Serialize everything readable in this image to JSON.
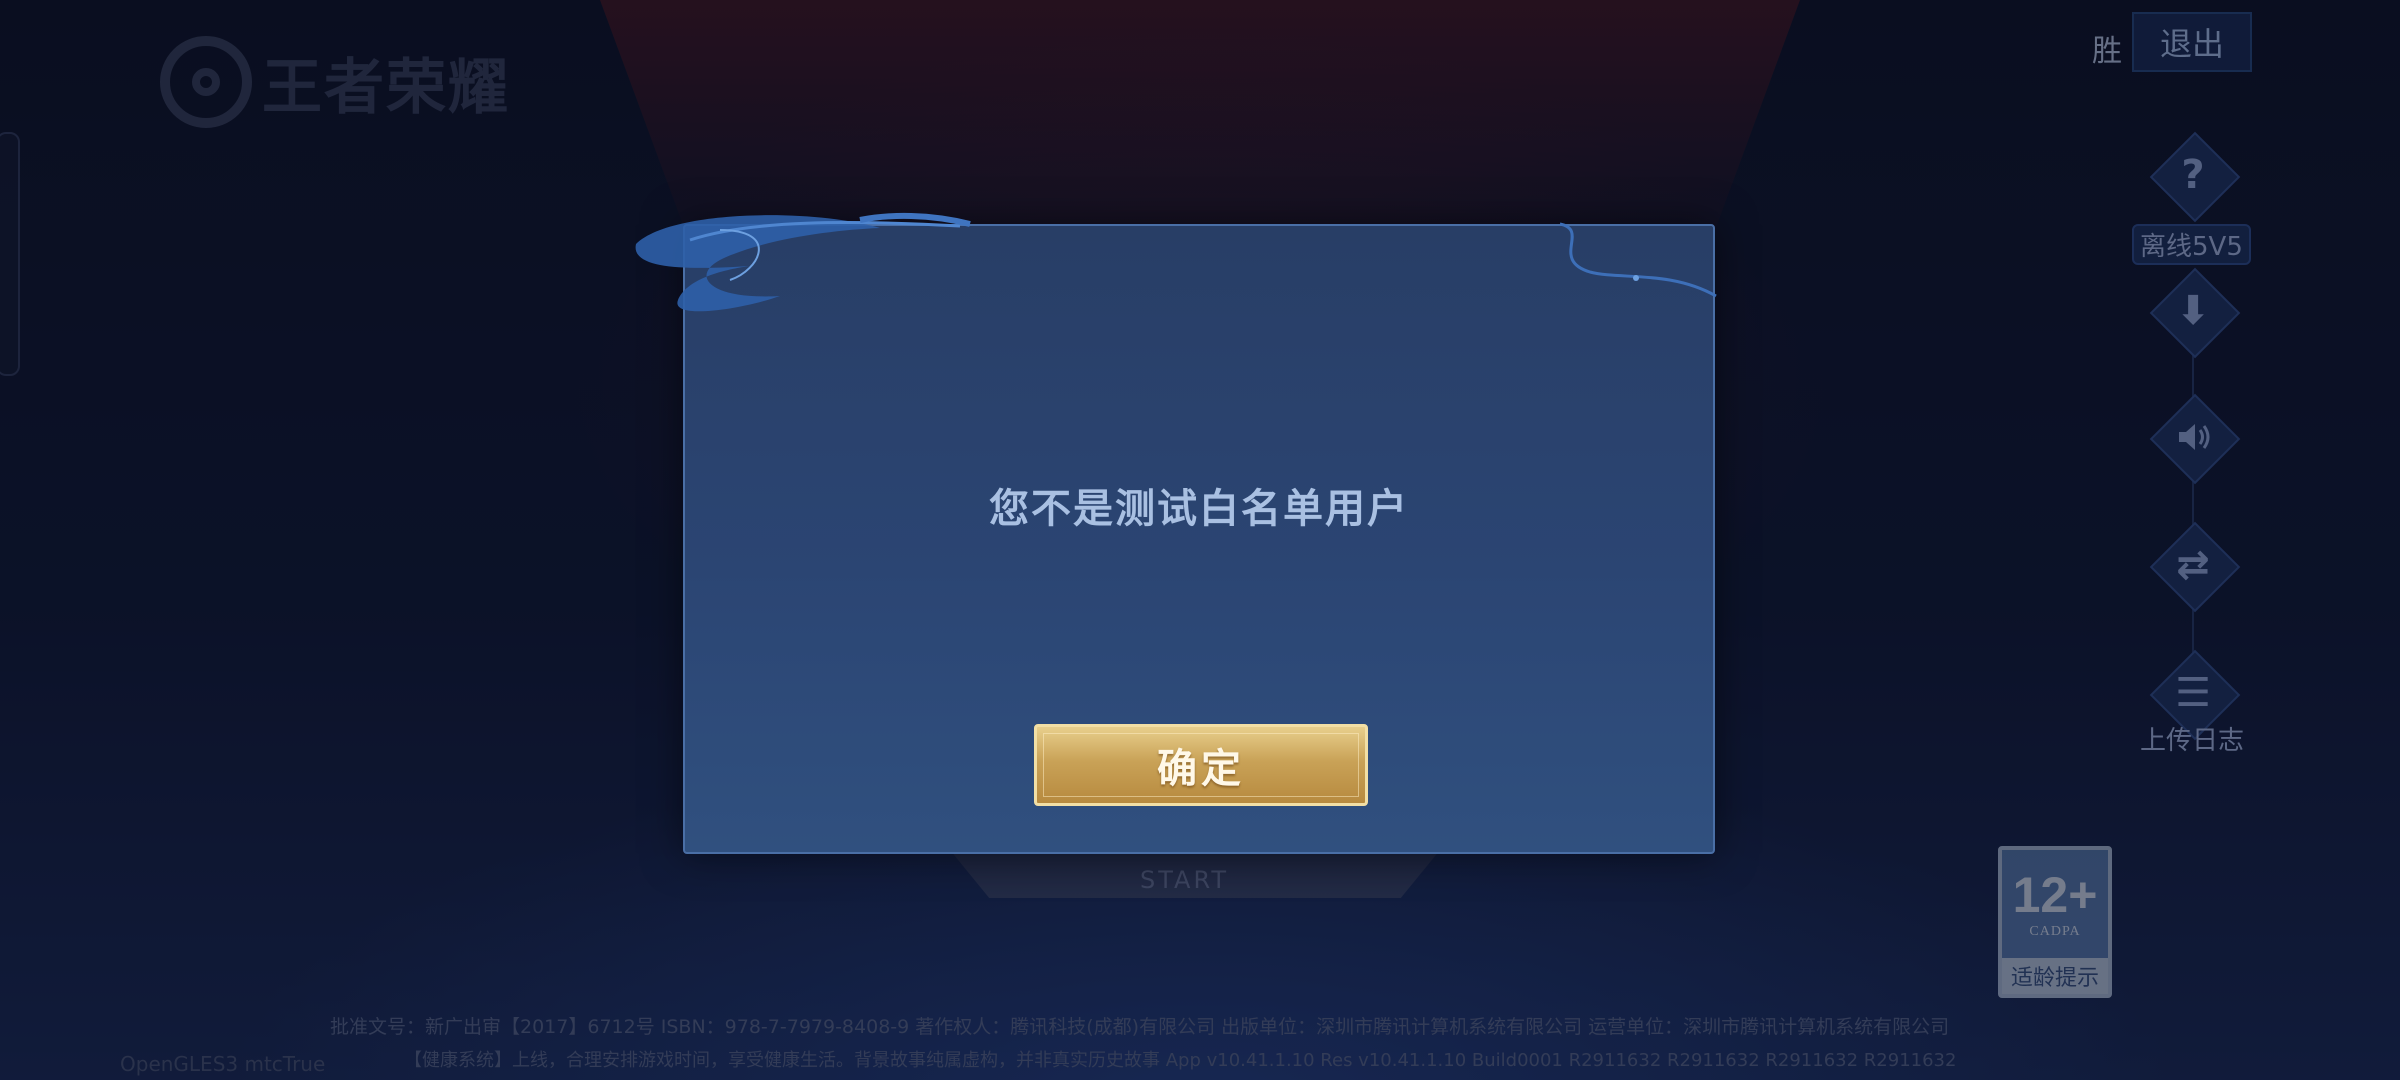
{
  "logo": {
    "text": "王者荣耀"
  },
  "top_right": {
    "win_label": "胜",
    "exit_label": "退出"
  },
  "side_menu": [
    {
      "name": "help",
      "icon": "question-icon",
      "glyph": "?",
      "label": "离线5V5"
    },
    {
      "name": "download",
      "icon": "download-icon",
      "glyph": "⬇",
      "label": ""
    },
    {
      "name": "sound",
      "icon": "speaker-icon",
      "glyph": "🔊",
      "label": ""
    },
    {
      "name": "switch",
      "icon": "phone-switch-icon",
      "glyph": "⇄",
      "label": ""
    },
    {
      "name": "upload-log",
      "icon": "clipboard-icon",
      "glyph": "☰",
      "label": "上传日志"
    }
  ],
  "modal": {
    "message": "您不是测试白名单用户",
    "confirm_label": "确定"
  },
  "age_rating": {
    "number": "12+",
    "org": "CADPA",
    "hint": "适龄提示"
  },
  "start_button": {
    "label": "START"
  },
  "footer": {
    "line1": "批准文号：新广出审【2017】6712号  ISBN：978-7-7979-8408-9  著作权人：腾讯科技(成都)有限公司  出版单位：深圳市腾讯计算机系统有限公司  运营单位：深圳市腾讯计算机系统有限公司",
    "line2": "【健康系统】上线，合理安排游戏时间，享受健康生活。背景故事纯属虚构，并非真实历史故事 App v10.41.1.10 Res v10.41.1.10 Build0001 R2911632 R2911632 R2911632 R2911632",
    "opengl": "OpenGLES3 mtcTrue"
  },
  "colors": {
    "modal_bg": "#2b4573",
    "confirm_gold": "#c9a257",
    "accent_text": "#a9c0e2"
  }
}
